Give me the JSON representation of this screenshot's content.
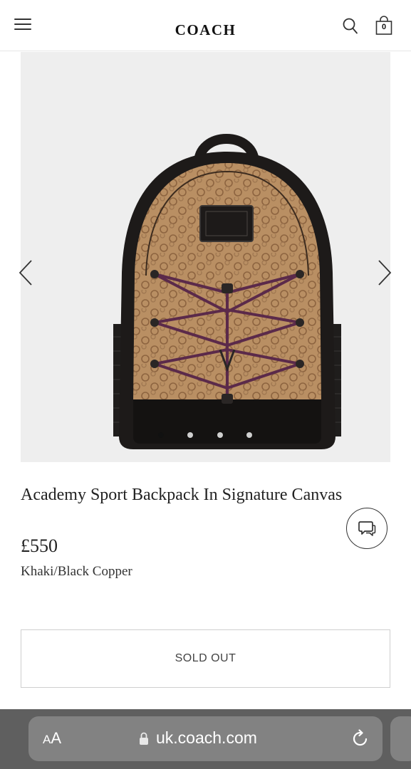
{
  "header": {
    "logo": "COACH",
    "bag_count": "0"
  },
  "carousel": {
    "total_slides": 4,
    "active_slide": 1
  },
  "product": {
    "title": "Academy Sport Backpack In Signature Canvas",
    "price": "£550",
    "color": "Khaki/Black Copper",
    "button_label": "SOLD OUT"
  },
  "browser": {
    "aa_label_big": "A",
    "aa_label_small": "A",
    "url": "uk.coach.com"
  },
  "colors": {
    "carousel_bg": "#eeeeee",
    "browser_bar": "#5f5f5f",
    "address_pill": "#828282",
    "canvas_khaki": "#b98f63",
    "leather_black": "#1d1a19",
    "cord_purple": "#5b2a4a"
  },
  "icons": [
    "hamburger-menu-icon",
    "search-icon",
    "shopping-bag-icon",
    "chevron-left-icon",
    "chevron-right-icon",
    "chat-icon",
    "lock-icon",
    "reload-icon"
  ]
}
